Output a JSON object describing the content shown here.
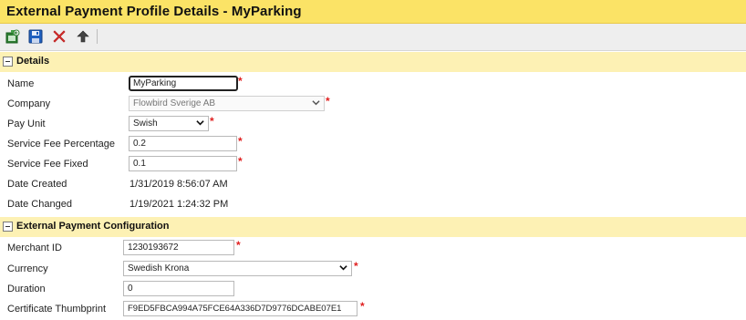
{
  "page": {
    "title": "External Payment Profile Details - MyParking"
  },
  "toolbar": {
    "icons": [
      "back-icon",
      "save-icon",
      "delete-icon",
      "upload-icon"
    ]
  },
  "details": {
    "section_title": "Details",
    "name_label": "Name",
    "name_value": "MyParking",
    "company_label": "Company",
    "company_value": "Flowbird Sverige AB",
    "pay_unit_label": "Pay Unit",
    "pay_unit_value": "Swish",
    "service_fee_pct_label": "Service Fee Percentage",
    "service_fee_pct_value": "0.2",
    "service_fee_fixed_label": "Service Fee Fixed",
    "service_fee_fixed_value": "0.1",
    "date_created_label": "Date Created",
    "date_created_value": "1/31/2019 8:56:07 AM",
    "date_changed_label": "Date Changed",
    "date_changed_value": "1/19/2021 1:24:32 PM"
  },
  "config": {
    "section_title": "External Payment Configuration",
    "merchant_id_label": "Merchant ID",
    "merchant_id_value": "1230193672",
    "currency_label": "Currency",
    "currency_value": "Swedish Krona",
    "duration_label": "Duration",
    "duration_value": "0",
    "thumbprint_label": "Certificate Thumbprint",
    "thumbprint_value": "F9ED5FBCA994A75FCE64A336D7D9776DCABE07E1"
  },
  "required_marker": "*",
  "colors": {
    "title_bg": "#fbe366",
    "section_bg": "#fdf1b4",
    "required": "#e02020"
  }
}
